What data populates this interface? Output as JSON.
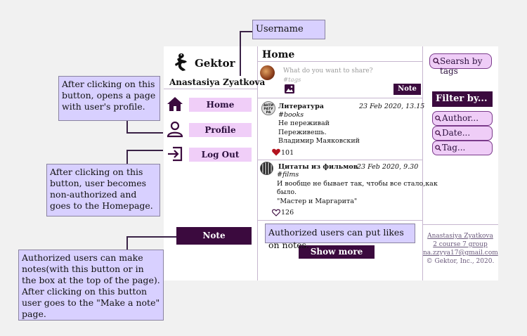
{
  "sidebar": {
    "brand": "Gektor",
    "username": "Anastasiya Zyatkova",
    "nav": [
      "Home",
      "Profile",
      "Log Out"
    ],
    "note_button": "Note"
  },
  "feed": {
    "title": "Home",
    "composer_placeholder": "What do you want to share?",
    "composer_tags": "#tags",
    "composer_note_button": "Note",
    "posts": [
      {
        "author": "Литература",
        "date": "23 Feb 2020, 13.15",
        "tag": "#books",
        "lines": [
          "Не переживай",
          "Переживешь.",
          "Владимир Маяковский"
        ],
        "likes": "101",
        "liked": true,
        "avatar_text": "АНТИ\nРАТУ\nРА"
      },
      {
        "author": "Цитаты из фильмов",
        "date": "23 Feb 2020, 9.30",
        "tag": "#films",
        "lines": [
          "И вообще не бывает так, чтобы все стало,как",
          "было.",
          "\"Мастер и Маргарита\""
        ],
        "likes": "126",
        "liked": false
      }
    ],
    "show_more": "Show more"
  },
  "right": {
    "search_label": "Searsh by tags",
    "filter_title": "Filter by...",
    "filters": [
      "Author...",
      "Date...",
      "Tag..."
    ],
    "footer": {
      "name": "Anastasiya Zyatkova",
      "course": "2 course 7 group",
      "email": "na.zzyya17@gmail.com",
      "copyright": "© Gektor, Inc., 2020."
    }
  },
  "callouts": {
    "username": "Username",
    "profile": "After clicking on this button, opens a page with user's profile.",
    "logout": "After clicking on this button, user becomes non-authorized and goes to the Homepage.",
    "note": "Authorized users can make notes(with this button or in the box at the top of the page). After clicking on this button user goes to the \"Make a note\" page.",
    "likes": "Authorized users can put likes on notes."
  },
  "colors": {
    "accent_dark": "#3b0a3e",
    "pill": "#f0cef8",
    "callout": "#d8d0ff",
    "like_red": "#b3141f"
  }
}
